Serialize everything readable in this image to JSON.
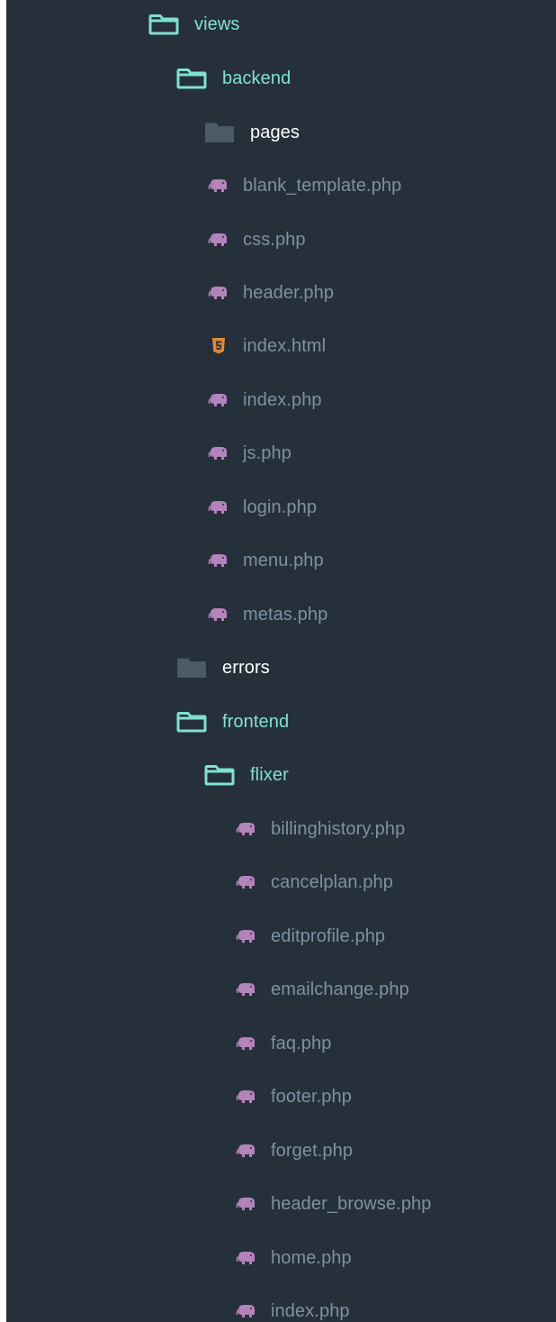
{
  "tree": {
    "items": [
      {
        "label": "views",
        "kind": "folder-open",
        "icon": "folder-open-icon",
        "name": "folder-views"
      },
      {
        "label": "backend",
        "kind": "folder-open",
        "icon": "folder-open-icon",
        "name": "folder-backend"
      },
      {
        "label": "pages",
        "kind": "folder-closed",
        "icon": "folder-closed-icon",
        "name": "folder-pages"
      },
      {
        "label": "blank_template.php",
        "kind": "php",
        "icon": "php-elephant-icon",
        "name": "file-blank-template-php"
      },
      {
        "label": "css.php",
        "kind": "php",
        "icon": "php-elephant-icon",
        "name": "file-css-php"
      },
      {
        "label": "header.php",
        "kind": "php",
        "icon": "php-elephant-icon",
        "name": "file-header-php"
      },
      {
        "label": "index.html",
        "kind": "html",
        "icon": "html5-icon",
        "name": "file-index-html"
      },
      {
        "label": "index.php",
        "kind": "php",
        "icon": "php-elephant-icon",
        "name": "file-index-php"
      },
      {
        "label": "js.php",
        "kind": "php",
        "icon": "php-elephant-icon",
        "name": "file-js-php"
      },
      {
        "label": "login.php",
        "kind": "php",
        "icon": "php-elephant-icon",
        "name": "file-login-php"
      },
      {
        "label": "menu.php",
        "kind": "php",
        "icon": "php-elephant-icon",
        "name": "file-menu-php"
      },
      {
        "label": "metas.php",
        "kind": "php",
        "icon": "php-elephant-icon",
        "name": "file-metas-php"
      },
      {
        "label": "errors",
        "kind": "folder-closed",
        "icon": "folder-closed-icon",
        "name": "folder-errors"
      },
      {
        "label": "frontend",
        "kind": "folder-open",
        "icon": "folder-open-icon",
        "name": "folder-frontend"
      },
      {
        "label": "flixer",
        "kind": "folder-open",
        "icon": "folder-open-icon",
        "name": "folder-flixer"
      },
      {
        "label": "billinghistory.php",
        "kind": "php",
        "icon": "php-elephant-icon",
        "name": "file-billinghistory-php"
      },
      {
        "label": "cancelplan.php",
        "kind": "php",
        "icon": "php-elephant-icon",
        "name": "file-cancelplan-php"
      },
      {
        "label": "editprofile.php",
        "kind": "php",
        "icon": "php-elephant-icon",
        "name": "file-editprofile-php"
      },
      {
        "label": "emailchange.php",
        "kind": "php",
        "icon": "php-elephant-icon",
        "name": "file-emailchange-php"
      },
      {
        "label": "faq.php",
        "kind": "php",
        "icon": "php-elephant-icon",
        "name": "file-faq-php"
      },
      {
        "label": "footer.php",
        "kind": "php",
        "icon": "php-elephant-icon",
        "name": "file-footer-php"
      },
      {
        "label": "forget.php",
        "kind": "php",
        "icon": "php-elephant-icon",
        "name": "file-forget-php"
      },
      {
        "label": "header_browse.php",
        "kind": "php",
        "icon": "php-elephant-icon",
        "name": "file-header-browse-php"
      },
      {
        "label": "home.php",
        "kind": "php",
        "icon": "php-elephant-icon",
        "name": "file-home-php"
      },
      {
        "label": "index.php",
        "kind": "php",
        "icon": "php-elephant-icon",
        "name": "file-flixer-index-php"
      }
    ]
  },
  "colors": {
    "panel_bg": "#26303a",
    "open_folder": "#80e0d3",
    "closed_folder": "#4a5a66",
    "file_text": "#7e91a3",
    "php_icon": "#b583bc",
    "html_icon": "#e0883c"
  }
}
